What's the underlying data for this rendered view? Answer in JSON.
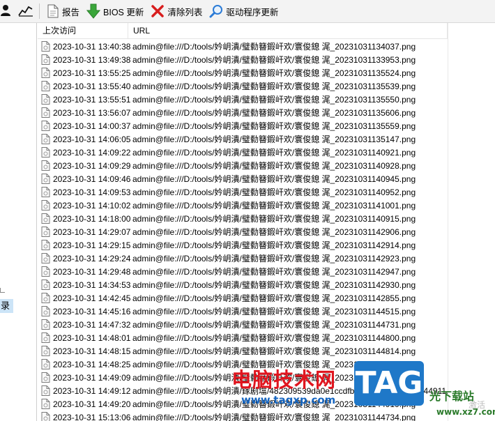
{
  "toolbar": {
    "report_label": "报告",
    "bios_label": "BIOS 更新",
    "clear_label": "清除列表",
    "driver_label": "驱动程序更新"
  },
  "left_panel": {
    "selected_fragment": "录"
  },
  "table": {
    "headers": [
      "上次访问",
      "URL"
    ],
    "rows": [
      {
        "time": "2023-10-31 13:40:38",
        "url": "admin@file:///D:/tools/妗岄潰/璧勬簮鍜屽欢/寰俊鎴   浘_20231031134037.png"
      },
      {
        "time": "2023-10-31 13:49:38",
        "url": "admin@file:///D:/tools/妗岄潰/璧勬簮鍜屽欢/寰俊鎴   浘_20231031133953.png"
      },
      {
        "time": "2023-10-31 13:55:25",
        "url": "admin@file:///D:/tools/妗岄潰/璧勬簮鍜屽欢/寰俊鎴   浘_20231031135524.png"
      },
      {
        "time": "2023-10-31 13:55:40",
        "url": "admin@file:///D:/tools/妗岄潰/璧勬簮鍜屽欢/寰俊鎴   浘_20231031135539.png"
      },
      {
        "time": "2023-10-31 13:55:51",
        "url": "admin@file:///D:/tools/妗岄潰/璧勬簮鍜屽欢/寰俊鎴   浘_20231031135550.png"
      },
      {
        "time": "2023-10-31 13:56:07",
        "url": "admin@file:///D:/tools/妗岄潰/璧勬簮鍜屽欢/寰俊鎴   浘_20231031135606.png"
      },
      {
        "time": "2023-10-31 14:00:37",
        "url": "admin@file:///D:/tools/妗岄潰/璧勬簮鍜屽欢/寰俊鎴   浘_20231031135559.png"
      },
      {
        "time": "2023-10-31 14:06:05",
        "url": "admin@file:///D:/tools/妗岄潰/璧勬簮鍜屽欢/寰俊鎴   浘_20231031135147.png"
      },
      {
        "time": "2023-10-31 14:09:22",
        "url": "admin@file:///D:/tools/妗岄潰/璧勬簮鍜屽欢/寰俊鎴   浘_20231031140921.png"
      },
      {
        "time": "2023-10-31 14:09:29",
        "url": "admin@file:///D:/tools/妗岄潰/璧勬簮鍜屽欢/寰俊鎴   浘_20231031140928.png"
      },
      {
        "time": "2023-10-31 14:09:46",
        "url": "admin@file:///D:/tools/妗岄潰/璧勬簮鍜屽欢/寰俊鎴   浘_20231031140945.png"
      },
      {
        "time": "2023-10-31 14:09:53",
        "url": "admin@file:///D:/tools/妗岄潰/璧勬簮鍜屽欢/寰俊鎴   浘_20231031140952.png"
      },
      {
        "time": "2023-10-31 14:10:02",
        "url": "admin@file:///D:/tools/妗岄潰/璧勬簮鍜屽欢/寰俊鎴   浘_20231031141001.png"
      },
      {
        "time": "2023-10-31 14:18:00",
        "url": "admin@file:///D:/tools/妗岄潰/璧勬簮鍜屽欢/寰俊鎴   浘_20231031140915.png"
      },
      {
        "time": "2023-10-31 14:29:07",
        "url": "admin@file:///D:/tools/妗岄潰/璧勬簮鍜屽欢/寰俊鎴   浘_20231031142906.png"
      },
      {
        "time": "2023-10-31 14:29:15",
        "url": "admin@file:///D:/tools/妗岄潰/璧勬簮鍜屽欢/寰俊鎴   浘_20231031142914.png"
      },
      {
        "time": "2023-10-31 14:29:24",
        "url": "admin@file:///D:/tools/妗岄潰/璧勬簮鍜屽欢/寰俊鎴   浘_20231031142923.png"
      },
      {
        "time": "2023-10-31 14:29:48",
        "url": "admin@file:///D:/tools/妗岄潰/璧勬簮鍜屽欢/寰俊鎴   浘_20231031142947.png"
      },
      {
        "time": "2023-10-31 14:34:53",
        "url": "admin@file:///D:/tools/妗岄潰/璧勬簮鍜屽欢/寰俊鎴   浘_20231031142930.png"
      },
      {
        "time": "2023-10-31 14:42:45",
        "url": "admin@file:///D:/tools/妗岄潰/璧勬簮鍜屽欢/寰俊鎴   浘_20231031142855.png"
      },
      {
        "time": "2023-10-31 14:45:16",
        "url": "admin@file:///D:/tools/妗岄潰/璧勬簮鍜屽欢/寰俊鎴   浘_20231031144515.png"
      },
      {
        "time": "2023-10-31 14:47:32",
        "url": "admin@file:///D:/tools/妗岄潰/璧勬簮鍜屽欢/寰俊鎴   浘_20231031144731.png"
      },
      {
        "time": "2023-10-31 14:48:01",
        "url": "admin@file:///D:/tools/妗岄潰/璧勬簮鍜屽欢/寰俊鎴   浘_20231031144800.png"
      },
      {
        "time": "2023-10-31 14:48:15",
        "url": "admin@file:///D:/tools/妗岄潰/璧勬簮鍜屽欢/寰俊鎴   浘_20231031144814.png"
      },
      {
        "time": "2023-10-31 14:48:25",
        "url": "admin@file:///D:/tools/妗岄潰/璧勬簮鍜屽欢/寰俊鎴   浘_20231031144824.png"
      },
      {
        "time": "2023-10-31 14:49:09",
        "url": "admin@file:///D:/tools/妗岄潰/璧勬簮鍜屽欢/寰俊鎴   浘_20231031144908.png"
      },
      {
        "time": "2023-10-31 14:49:12",
        "url": "admin@file:///D:/tools/妗岄潰/鎵剧墖/482309539da0e1ccdfbed4a5_20231031144911.png"
      },
      {
        "time": "2023-10-31 14:49:20",
        "url": "admin@file:///D:/tools/妗岄潰/璧勬簮鍜屽欢/寰俊鎴   浘_20231031144919.png"
      },
      {
        "time": "2023-10-31 15:13:06",
        "url": "admin@file:///D:/tools/妗岄潰/璧勬簮鍜屽欢/寰俊鎴   浘_20231031144734.png"
      }
    ]
  },
  "watermarks": {
    "site_name": "电脑技术网",
    "site_url": "www.tagxp.com",
    "tag": "TAG",
    "site2_name": "光下载站",
    "site2_url": "www.xz7.com",
    "faint": "激活"
  },
  "colors": {
    "toolbar_bg": "#f3f3f3",
    "selection": "#cce4f7",
    "bios_arrow": "#3aa63a",
    "clear_x": "#d81e1e",
    "driver_search": "#2b7bd6"
  }
}
